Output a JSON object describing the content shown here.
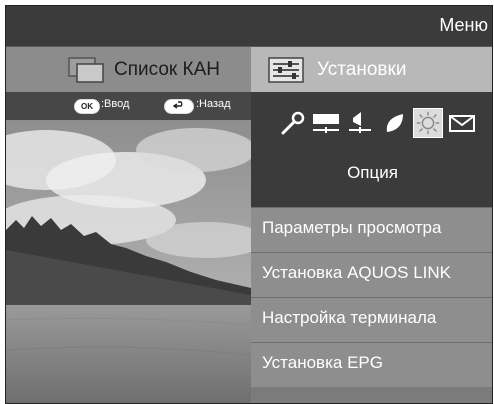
{
  "menu": {
    "title": "Меню"
  },
  "header": {
    "left_tab": "Список КАН",
    "right_tab": "Установки",
    "left_icon": "channel-list-icon",
    "right_icon": "settings-sliders-icon"
  },
  "hints": {
    "ok_key": "OK",
    "ok_label": ":Ввод",
    "back_label": ":Назад",
    "back_icon": "return-arrow-icon"
  },
  "categories": {
    "icons": [
      "wrench-icon",
      "picture-icon",
      "audio-icon",
      "eco-leaf-icon",
      "option-sun-icon",
      "mail-icon"
    ],
    "selected": "Опция"
  },
  "items": [
    {
      "label": "Параметры просмотра"
    },
    {
      "label": "Установка AQUOS LINK"
    },
    {
      "label": "Настройка терминала"
    },
    {
      "label": "Установка EPG"
    }
  ],
  "colors": {
    "highlight": "#b8b8b8",
    "panel": "#8e8e8e",
    "dark": "#3b3b3b"
  }
}
